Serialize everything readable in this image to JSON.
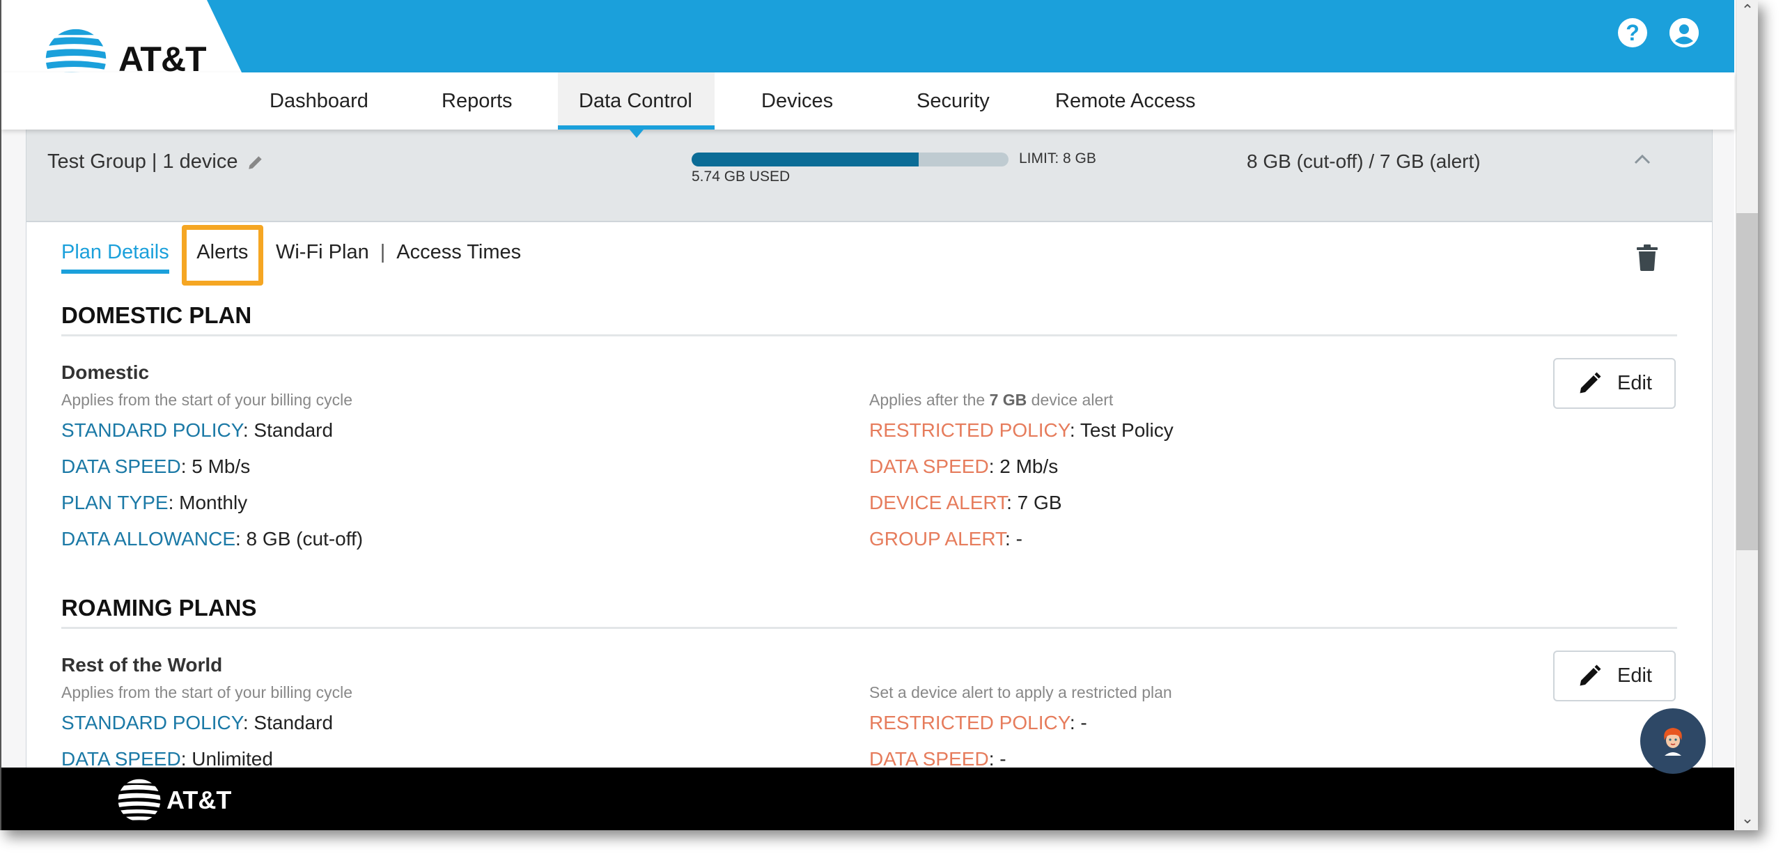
{
  "brand": {
    "name": "AT&T",
    "accent": "#1ba0db",
    "footer_name": "AT&T"
  },
  "header": {
    "icons": [
      {
        "name": "help-icon",
        "glyph": "?"
      },
      {
        "name": "account-icon",
        "glyph": ""
      }
    ]
  },
  "nav": {
    "items": [
      {
        "label": "Dashboard",
        "active": false
      },
      {
        "label": "Reports",
        "active": false
      },
      {
        "label": "Data Control",
        "active": true
      },
      {
        "label": "Devices",
        "active": false
      },
      {
        "label": "Security",
        "active": false
      },
      {
        "label": "Remote Access",
        "active": false
      }
    ]
  },
  "group": {
    "title": "Test Group | 1 device",
    "usage_used_label": "5.74 GB USED",
    "usage_used_gb": 5.74,
    "usage_limit_gb": 8,
    "usage_limit_label": "LIMIT: 8 GB",
    "summary": "8 GB (cut-off) / 7 GB (alert)"
  },
  "tabs": {
    "items": [
      {
        "label": "Plan Details",
        "active": true
      },
      {
        "label": "Alerts",
        "active": false,
        "highlighted": true
      },
      {
        "label": "Wi-Fi Plan",
        "active": false
      },
      {
        "label": "Access Times",
        "active": false
      }
    ],
    "separator": "|"
  },
  "domestic": {
    "section_title": "DOMESTIC PLAN",
    "plan_name": "Domestic",
    "standard_hint": "Applies from the start of your billing cycle",
    "restricted_hint_pre": "Applies after the ",
    "restricted_hint_bold": "7 GB",
    "restricted_hint_post": " device alert",
    "standard": [
      {
        "key": "STANDARD POLICY",
        "value": ": Standard"
      },
      {
        "key": "DATA SPEED",
        "value": ": 5 Mb/s"
      },
      {
        "key": "PLAN TYPE",
        "value": ": Monthly"
      },
      {
        "key": "DATA ALLOWANCE",
        "value": ": 8 GB (cut-off)"
      }
    ],
    "restricted": [
      {
        "key": "RESTRICTED POLICY",
        "value": ": Test Policy"
      },
      {
        "key": "DATA SPEED",
        "value": ": 2 Mb/s"
      },
      {
        "key": "DEVICE ALERT",
        "value": ": 7 GB"
      },
      {
        "key": "GROUP ALERT",
        "value": ": -"
      }
    ],
    "edit_label": "Edit"
  },
  "roaming": {
    "section_title": "ROAMING PLANS",
    "plan_name": "Rest of the World",
    "standard_hint": "Applies from the start of your billing cycle",
    "restricted_hint": "Set a device alert to apply a restricted plan",
    "standard": [
      {
        "key": "STANDARD POLICY",
        "value": ": Standard"
      },
      {
        "key": "DATA SPEED",
        "value": ": Unlimited"
      }
    ],
    "restricted": [
      {
        "key": "RESTRICTED POLICY",
        "value": ": -"
      },
      {
        "key": "DATA SPEED",
        "value": ": -"
      }
    ],
    "edit_label": "Edit"
  },
  "colors": {
    "standard_key": "#1b79a6",
    "restricted_key": "#e67c5c",
    "usage_fill": "#0b6c96",
    "highlight": "#f5a623"
  }
}
